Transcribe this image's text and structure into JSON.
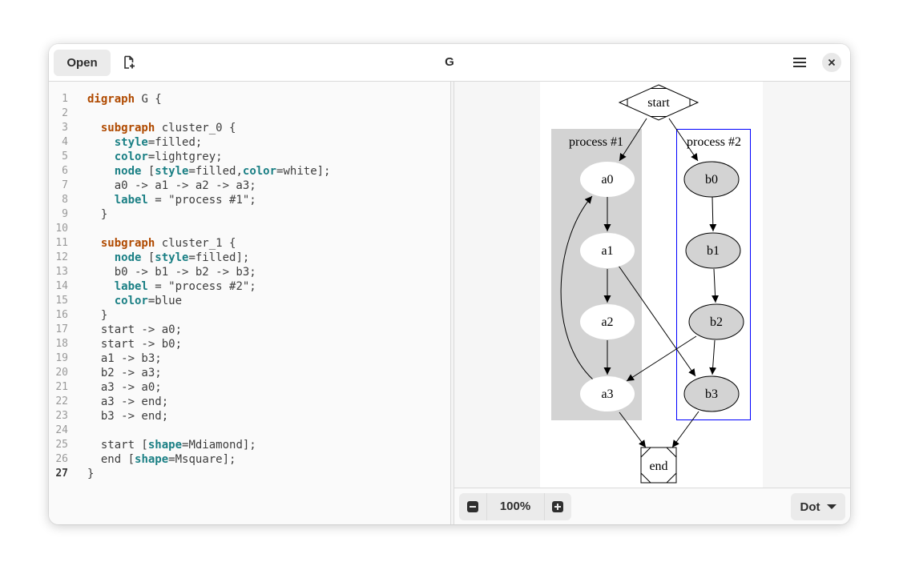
{
  "window": {
    "title": "G"
  },
  "header": {
    "open_label": "Open",
    "new_icon": "document-new-icon",
    "menu_icon": "hamburger-menu-icon",
    "close_icon": "close-icon"
  },
  "editor": {
    "current_line": 27,
    "lines": [
      [
        [
          "kw",
          "digraph"
        ],
        [
          "t",
          " G {"
        ]
      ],
      [],
      [
        [
          "t",
          "  "
        ],
        [
          "kw",
          "subgraph"
        ],
        [
          "t",
          " cluster_0 {"
        ]
      ],
      [
        [
          "t",
          "    "
        ],
        [
          "at",
          "style"
        ],
        [
          "t",
          "=filled;"
        ]
      ],
      [
        [
          "t",
          "    "
        ],
        [
          "at",
          "color"
        ],
        [
          "t",
          "=lightgrey;"
        ]
      ],
      [
        [
          "t",
          "    "
        ],
        [
          "at",
          "node"
        ],
        [
          "t",
          " ["
        ],
        [
          "at",
          "style"
        ],
        [
          "t",
          "=filled,"
        ],
        [
          "at",
          "color"
        ],
        [
          "t",
          "=white];"
        ]
      ],
      [
        [
          "t",
          "    a0 -> a1 -> a2 -> a3;"
        ]
      ],
      [
        [
          "t",
          "    "
        ],
        [
          "at",
          "label"
        ],
        [
          "t",
          " = \"process #1\";"
        ]
      ],
      [
        [
          "t",
          "  }"
        ]
      ],
      [],
      [
        [
          "t",
          "  "
        ],
        [
          "kw",
          "subgraph"
        ],
        [
          "t",
          " cluster_1 {"
        ]
      ],
      [
        [
          "t",
          "    "
        ],
        [
          "at",
          "node"
        ],
        [
          "t",
          " ["
        ],
        [
          "at",
          "style"
        ],
        [
          "t",
          "=filled];"
        ]
      ],
      [
        [
          "t",
          "    b0 -> b1 -> b2 -> b3;"
        ]
      ],
      [
        [
          "t",
          "    "
        ],
        [
          "at",
          "label"
        ],
        [
          "t",
          " = \"process #2\";"
        ]
      ],
      [
        [
          "t",
          "    "
        ],
        [
          "at",
          "color"
        ],
        [
          "t",
          "=blue"
        ]
      ],
      [
        [
          "t",
          "  }"
        ]
      ],
      [
        [
          "t",
          "  start -> a0;"
        ]
      ],
      [
        [
          "t",
          "  start -> b0;"
        ]
      ],
      [
        [
          "t",
          "  a1 -> b3;"
        ]
      ],
      [
        [
          "t",
          "  b2 -> a3;"
        ]
      ],
      [
        [
          "t",
          "  a3 -> a0;"
        ]
      ],
      [
        [
          "t",
          "  a3 -> end;"
        ]
      ],
      [
        [
          "t",
          "  b3 -> end;"
        ]
      ],
      [],
      [
        [
          "t",
          "  start ["
        ],
        [
          "at",
          "shape"
        ],
        [
          "t",
          "=Mdiamond];"
        ]
      ],
      [
        [
          "t",
          "  end ["
        ],
        [
          "at",
          "shape"
        ],
        [
          "t",
          "=Msquare];"
        ]
      ],
      [
        [
          "t",
          "}"
        ]
      ]
    ]
  },
  "graph": {
    "cluster_labels": [
      "process #1",
      "process #2"
    ],
    "cluster_colors": {
      "process_1_fill": "#d3d3d3",
      "process_2_border": "#0000ff"
    },
    "nodes": {
      "start": "start",
      "a0": "a0",
      "a1": "a1",
      "a2": "a2",
      "a3": "a3",
      "b0": "b0",
      "b1": "b1",
      "b2": "b2",
      "b3": "b3",
      "end": "end"
    }
  },
  "footer": {
    "zoom_out_icon": "minus-icon",
    "zoom_level": "100%",
    "zoom_in_icon": "plus-icon",
    "layout_engine": "Dot",
    "dropdown_icon": "chevron-down-icon"
  }
}
